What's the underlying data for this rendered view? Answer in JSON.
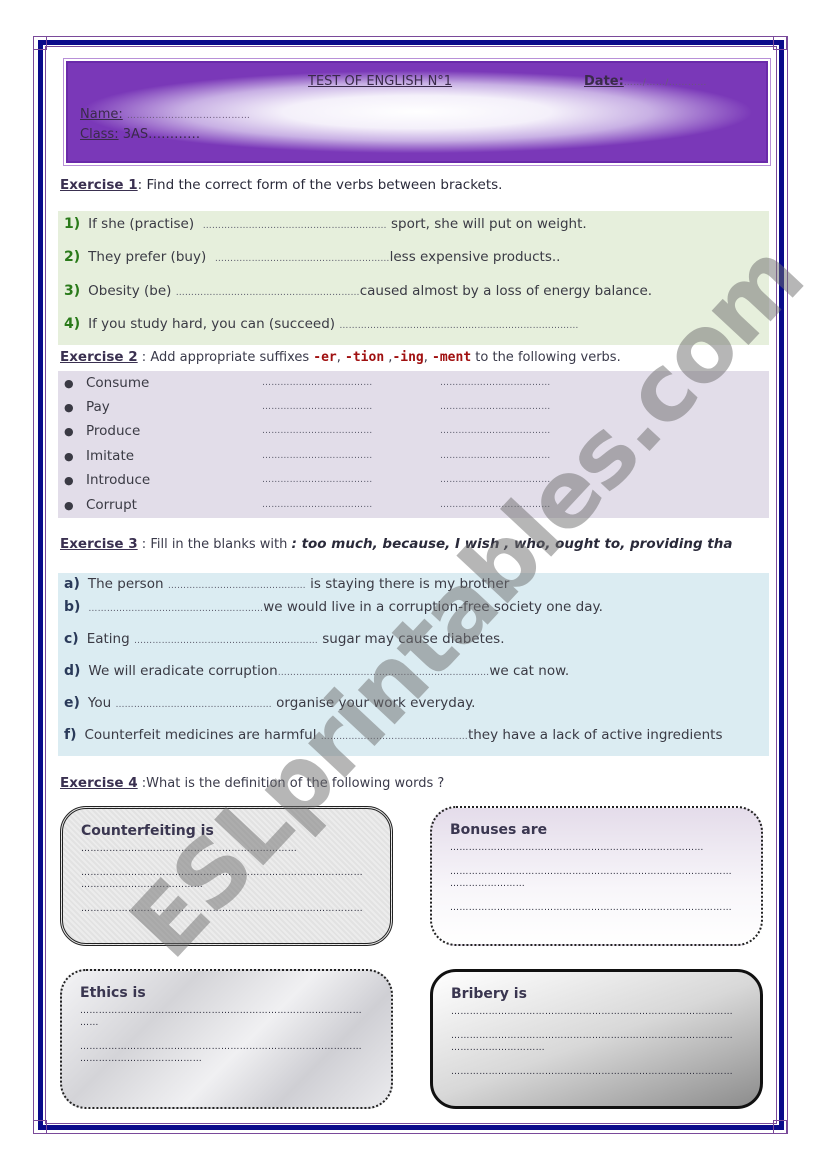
{
  "header": {
    "title": "TEST OF ENGLISH N°1",
    "date_label": "Date:",
    "date_value": "……/……/…………",
    "name_label": "Name:",
    "name_value": "…………………………………",
    "class_label": "Class:",
    "class_value": "3AS…………"
  },
  "exercise1": {
    "label": "Exercise 1",
    "instruction": ": Find the correct form of the verbs between brackets.",
    "items": [
      {
        "num": "1)",
        "before": "If she (practise)",
        "blank": "……………………………………………………",
        "after": " sport, she will put on weight."
      },
      {
        "num": "2)",
        "before": "They prefer (buy)",
        "blank": "…………………………………………………",
        "after": "less expensive products.."
      },
      {
        "num": "3)",
        "before": "Obesity (be)",
        "blank": "……………………………………………………",
        "after": "caused almost by a loss of energy balance."
      },
      {
        "num": "4)",
        "before": "If you study hard, you can (succeed)",
        "blank": "……………………………………………………………………",
        "after": ""
      }
    ]
  },
  "exercise2": {
    "label": "Exercise 2",
    "instruction_pre": " : Add appropriate suffixes ",
    "suffixes": [
      "-er",
      "-tion",
      "-ing",
      "-ment"
    ],
    "sep1": ", ",
    "sep2": " ,",
    "sep3": ", ",
    "instruction_post": " to the following verbs.",
    "items": [
      {
        "verb": "Consume",
        "blank1": "………………………………",
        "blank2": "………………………………"
      },
      {
        "verb": "Pay",
        "blank1": "………………………………",
        "blank2": "………………………………"
      },
      {
        "verb": "Produce",
        "blank1": "………………………………",
        "blank2": "………………………………"
      },
      {
        "verb": "Imitate",
        "blank1": "………………………………",
        "blank2": "………………………………"
      },
      {
        "verb": "Introduce",
        "blank1": "………………………………",
        "blank2": "………………………………"
      },
      {
        "verb": "Corrupt",
        "blank1": "………………………………",
        "blank2": "………………………………"
      }
    ]
  },
  "exercise3": {
    "label": "Exercise 3",
    "instruction": " : Fill in the blanks with ",
    "word_bank": ": too much,  because, I wish , who,  ought to,  providing tha",
    "items": [
      {
        "letter": "a)",
        "before": "The person ",
        "blank": "………………………………………",
        "after": " is staying there is my brother"
      },
      {
        "letter": "b)",
        "before": "",
        "blank": "…………………………………………………",
        "after": "we would live in a corruption-free society one day."
      },
      {
        "letter": "c)",
        "before": "Eating ",
        "blank": "……………………………………………………",
        "after": " sugar may cause diabetes."
      },
      {
        "letter": "d)",
        "before": "We will eradicate corruption",
        "blank": "……………………………………………………………",
        "after": "we cat now."
      },
      {
        "letter": "e)",
        "before": "You  ",
        "blank": "……………………………………………",
        "after": " organise your work everyday."
      },
      {
        "letter": "f)",
        "before": "Counterfeit medicines are harmful ",
        "blank": "…………………………………………",
        "after": "they have a lack of active ingredients"
      }
    ]
  },
  "exercise4": {
    "label": "Exercise 4",
    "instruction": " :What is the definition of the following words ?",
    "boxes": [
      {
        "title": "Counterfeiting is",
        "lines": [
          "……………………………………………………………",
          "………………………………………………………………………………",
          "…………………………………",
          "………………………………………………………………………………"
        ]
      },
      {
        "title": "Bonuses are",
        "lines": [
          "………………………………………………………………………",
          "………………………………………………………………………………",
          "……………………",
          "………………………………………………………………………………"
        ]
      },
      {
        "title": "Ethics is",
        "lines": [
          "………………………………………………………………………………",
          "……",
          "………………………………………………………………………………",
          "…………………………………"
        ]
      },
      {
        "title": "Bribery is",
        "lines": [
          "………………………………………………………………………………",
          "………………………………………………………………………………",
          "…………………………",
          "………………………………………………………………………………"
        ]
      }
    ]
  },
  "watermark": "ESLprintables.com"
}
